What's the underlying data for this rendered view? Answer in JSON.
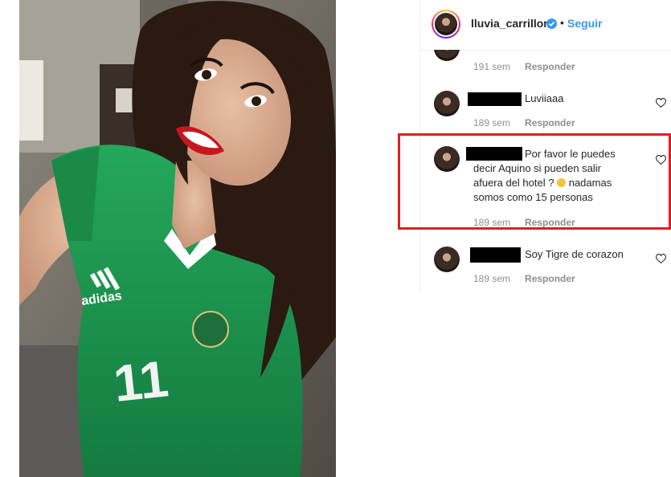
{
  "post": {
    "username": "lluvia_carrillor",
    "separator": "•",
    "follow_label": "Seguir"
  },
  "photo": {
    "jersey_brand": "adidas",
    "jersey_number": "11"
  },
  "comments": [
    {
      "text": "",
      "time": "191 sem",
      "reply_label": "Responder"
    },
    {
      "text": "Luviiaaa",
      "time": "189 sem",
      "reply_label": "Responder"
    },
    {
      "text_lines": [
        "Por favor le puedes",
        "decir Aquino si pueden salir",
        "afuera del hotel ?",
        "nadamas",
        "somos como 15 personas"
      ],
      "time": "189 sem",
      "reply_label": "Responder"
    },
    {
      "text": "Soy Tigre de corazon",
      "time": "189 sem",
      "reply_label": "Responder"
    }
  ],
  "colors": {
    "accent": "#3897f0",
    "highlight": "#d92125",
    "jersey": "#1f9a52"
  },
  "icons": [
    "verified-badge-icon",
    "heart-icon",
    "emoji-icon"
  ]
}
